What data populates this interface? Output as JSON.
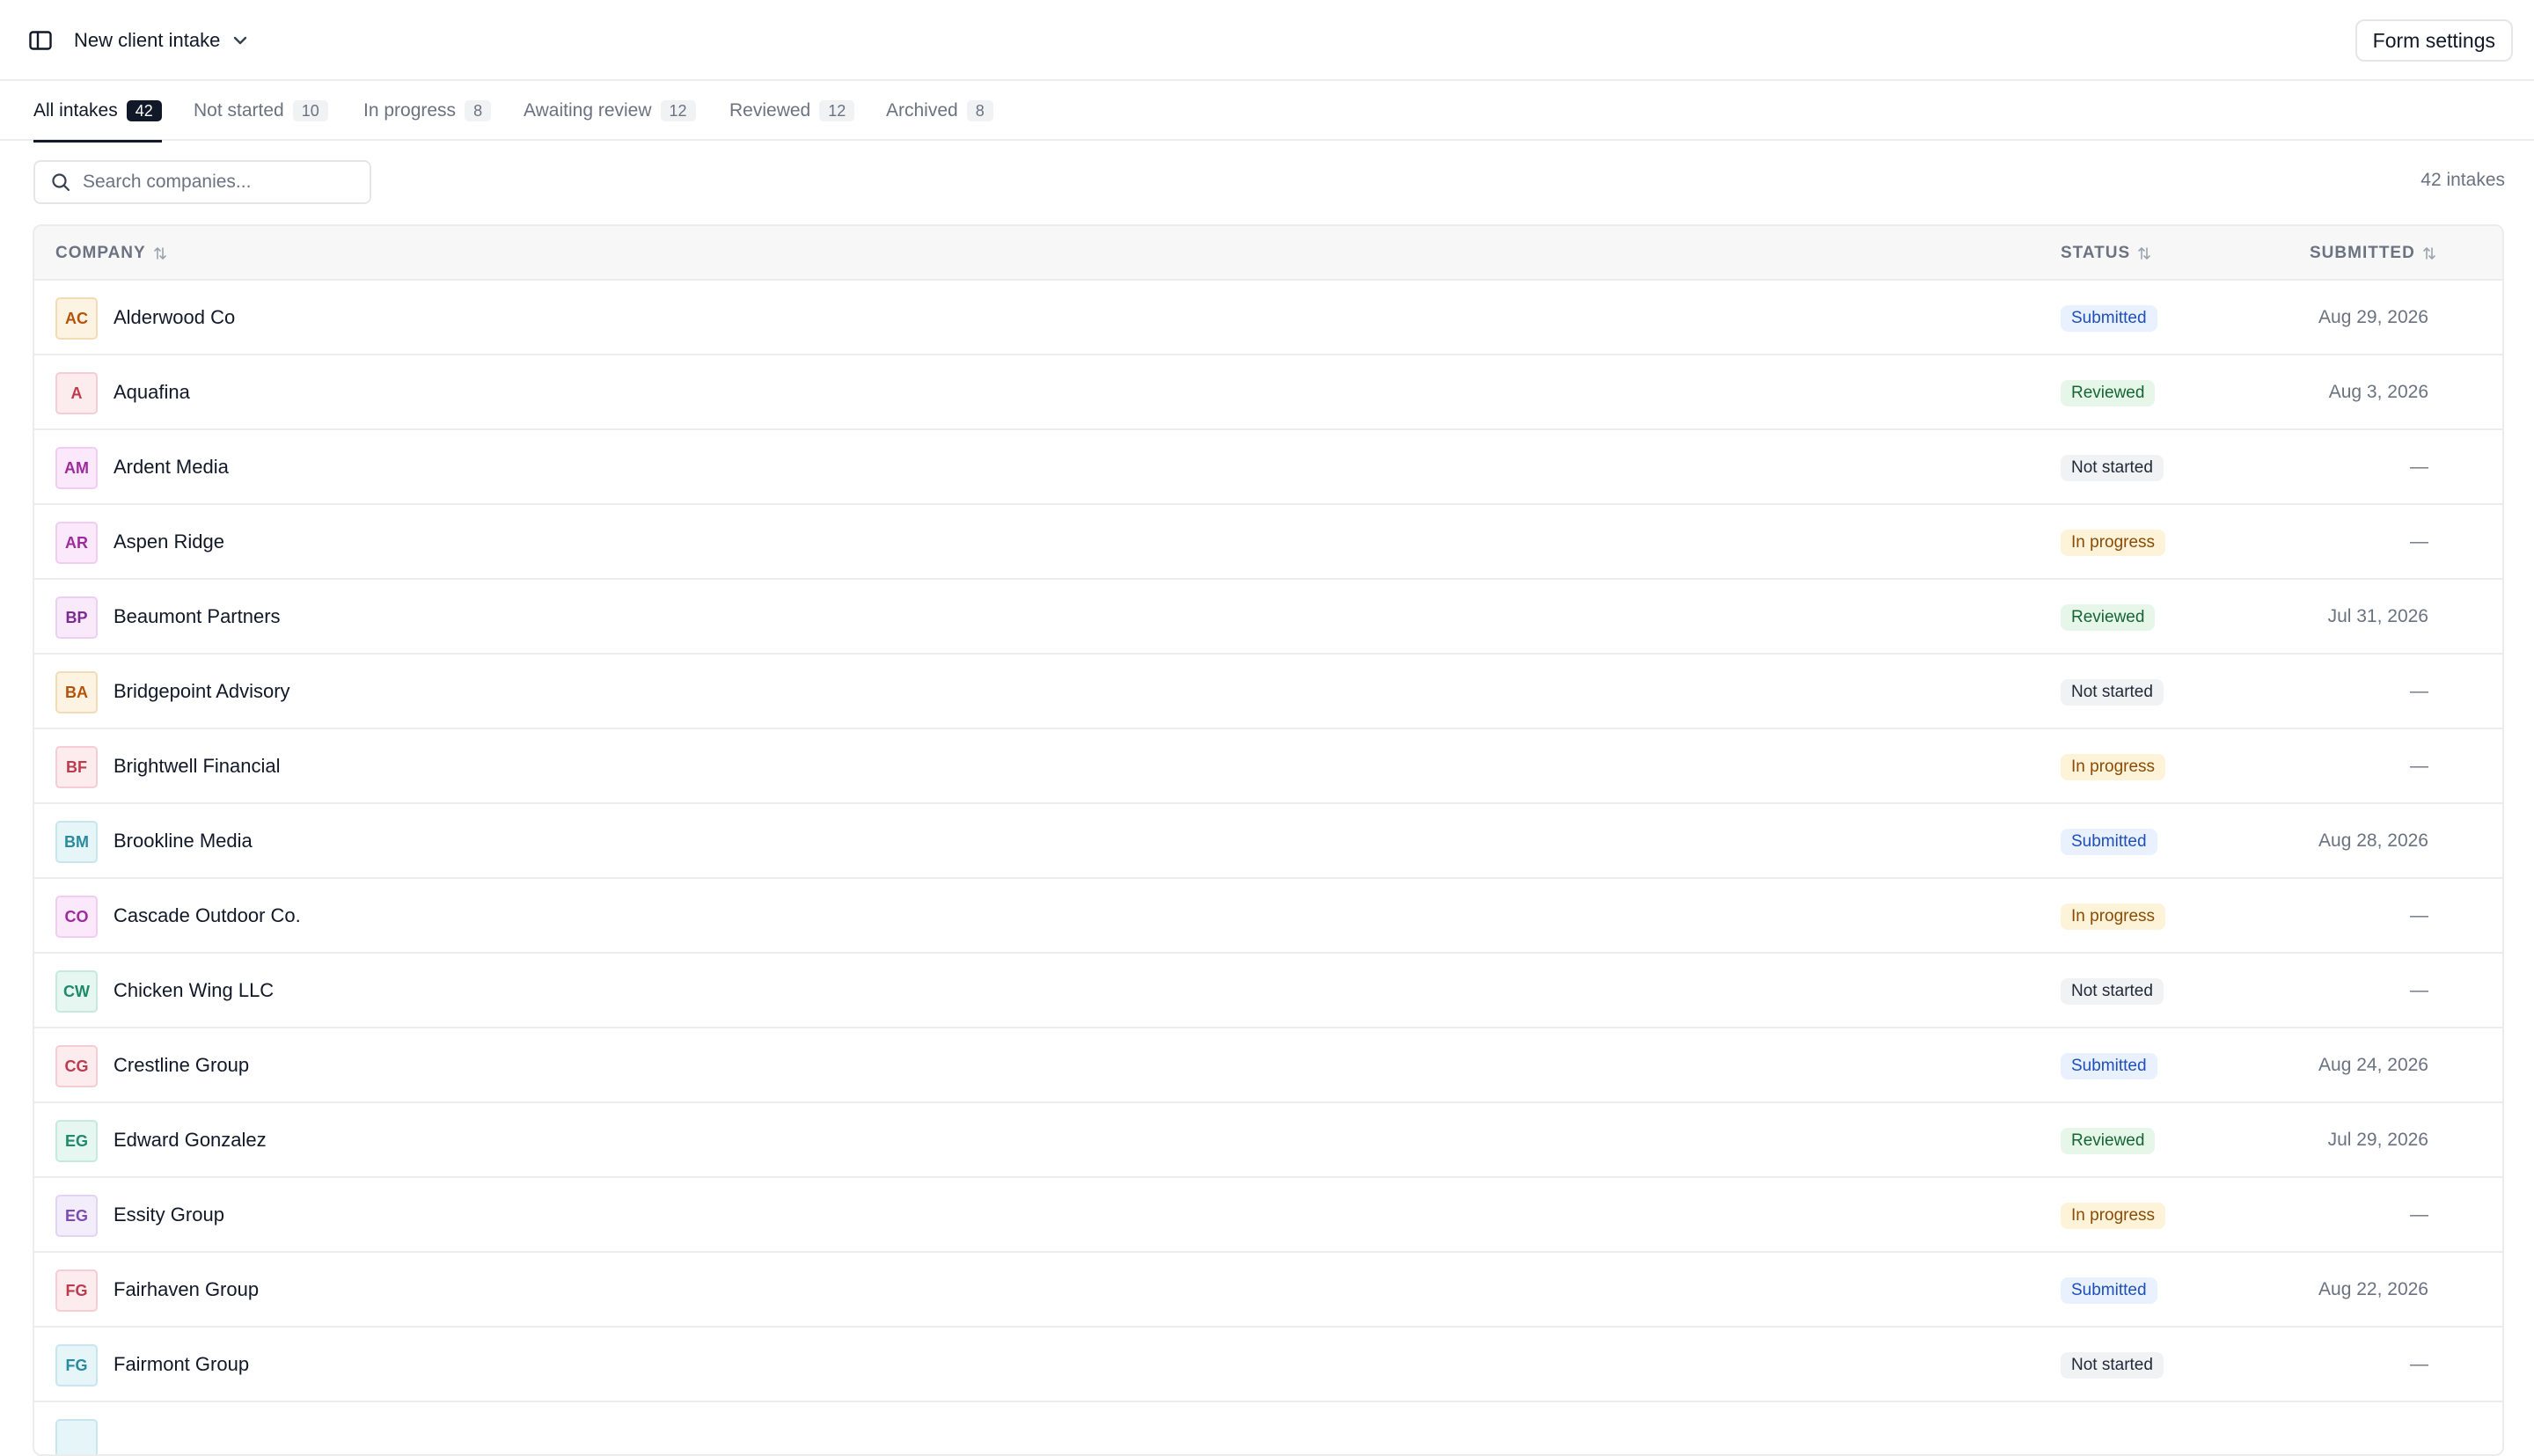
{
  "header": {
    "form_title": "New client intake",
    "form_settings_label": "Form settings"
  },
  "tabs": [
    {
      "label": "All intakes",
      "count": "42",
      "active": true
    },
    {
      "label": "Not started",
      "count": "10",
      "active": false
    },
    {
      "label": "In progress",
      "count": "8",
      "active": false
    },
    {
      "label": "Awaiting review",
      "count": "12",
      "active": false
    },
    {
      "label": "Reviewed",
      "count": "12",
      "active": false
    },
    {
      "label": "Archived",
      "count": "8",
      "active": false
    }
  ],
  "search": {
    "placeholder": "Search companies...",
    "value": ""
  },
  "intake_count": "42 intakes",
  "table": {
    "columns": {
      "company": "COMPANY",
      "status": "STATUS",
      "submitted": "SUBMITTED"
    },
    "rows": [
      {
        "initials": "AC",
        "company": "Alderwood Co",
        "status": "Submitted",
        "submitted": "Aug 29, 2026",
        "avatar_bg": "#fdf3e3",
        "avatar_fg": "#b45309",
        "avatar_border": "#f3dcb5"
      },
      {
        "initials": "A",
        "company": "Aquafina",
        "status": "Reviewed",
        "submitted": "Aug 3, 2026",
        "avatar_bg": "#fdecee",
        "avatar_fg": "#be3b4d",
        "avatar_border": "#f5cdd3"
      },
      {
        "initials": "AM",
        "company": "Ardent Media",
        "status": "Not started",
        "submitted": "—",
        "avatar_bg": "#fbe9fb",
        "avatar_fg": "#9d2b9d",
        "avatar_border": "#f1cdf1"
      },
      {
        "initials": "AR",
        "company": "Aspen Ridge",
        "status": "In progress",
        "submitted": "—",
        "avatar_bg": "#fbe9fb",
        "avatar_fg": "#9d2b9d",
        "avatar_border": "#f1cdf1"
      },
      {
        "initials": "BP",
        "company": "Beaumont Partners",
        "status": "Reviewed",
        "submitted": "Jul 31, 2026",
        "avatar_bg": "#f8eafb",
        "avatar_fg": "#7e2a93",
        "avatar_border": "#ecd0f3"
      },
      {
        "initials": "BA",
        "company": "Bridgepoint Advisory",
        "status": "Not started",
        "submitted": "—",
        "avatar_bg": "#fdf3e3",
        "avatar_fg": "#b45309",
        "avatar_border": "#f3dcb5"
      },
      {
        "initials": "BF",
        "company": "Brightwell Financial",
        "status": "In progress",
        "submitted": "—",
        "avatar_bg": "#fdecee",
        "avatar_fg": "#be3b4d",
        "avatar_border": "#f5cdd3"
      },
      {
        "initials": "BM",
        "company": "Brookline Media",
        "status": "Submitted",
        "submitted": "Aug 28, 2026",
        "avatar_bg": "#e6f5f8",
        "avatar_fg": "#2a8aa0",
        "avatar_border": "#c7e6ee"
      },
      {
        "initials": "CO",
        "company": "Cascade Outdoor Co.",
        "status": "In progress",
        "submitted": "—",
        "avatar_bg": "#fbe9fb",
        "avatar_fg": "#9d2b9d",
        "avatar_border": "#f1cdf1"
      },
      {
        "initials": "CW",
        "company": "Chicken Wing LLC",
        "status": "Not started",
        "submitted": "—",
        "avatar_bg": "#e6f6f1",
        "avatar_fg": "#1f8a6a",
        "avatar_border": "#c6eadf"
      },
      {
        "initials": "CG",
        "company": "Crestline Group",
        "status": "Submitted",
        "submitted": "Aug 24, 2026",
        "avatar_bg": "#fdecee",
        "avatar_fg": "#be3b4d",
        "avatar_border": "#f5cdd3"
      },
      {
        "initials": "EG",
        "company": "Edward Gonzalez",
        "status": "Reviewed",
        "submitted": "Jul 29, 2026",
        "avatar_bg": "#e6f6f1",
        "avatar_fg": "#1f8a6a",
        "avatar_border": "#c6eadf"
      },
      {
        "initials": "EG",
        "company": "Essity Group",
        "status": "In progress",
        "submitted": "—",
        "avatar_bg": "#f3ecfb",
        "avatar_fg": "#7b4bb0",
        "avatar_border": "#e2d4f3"
      },
      {
        "initials": "FG",
        "company": "Fairhaven Group",
        "status": "Submitted",
        "submitted": "Aug 22, 2026",
        "avatar_bg": "#fdecee",
        "avatar_fg": "#be3b4d",
        "avatar_border": "#f5cdd3"
      },
      {
        "initials": "FG",
        "company": "Fairmont Group",
        "status": "Not started",
        "submitted": "—",
        "avatar_bg": "#e6f5f8",
        "avatar_fg": "#2a8aa0",
        "avatar_border": "#c7e6ee"
      },
      {
        "initials": "",
        "company": "",
        "status": "",
        "submitted": "",
        "avatar_bg": "#e6f5f8",
        "avatar_fg": "#2a8aa0",
        "avatar_border": "#c7e6ee"
      }
    ]
  },
  "icons": {
    "sidebar_toggle": "sidebar-panel-icon",
    "title_dropdown": "chevron-down-icon",
    "search": "search-icon",
    "sort": "sort-arrows-icon"
  }
}
